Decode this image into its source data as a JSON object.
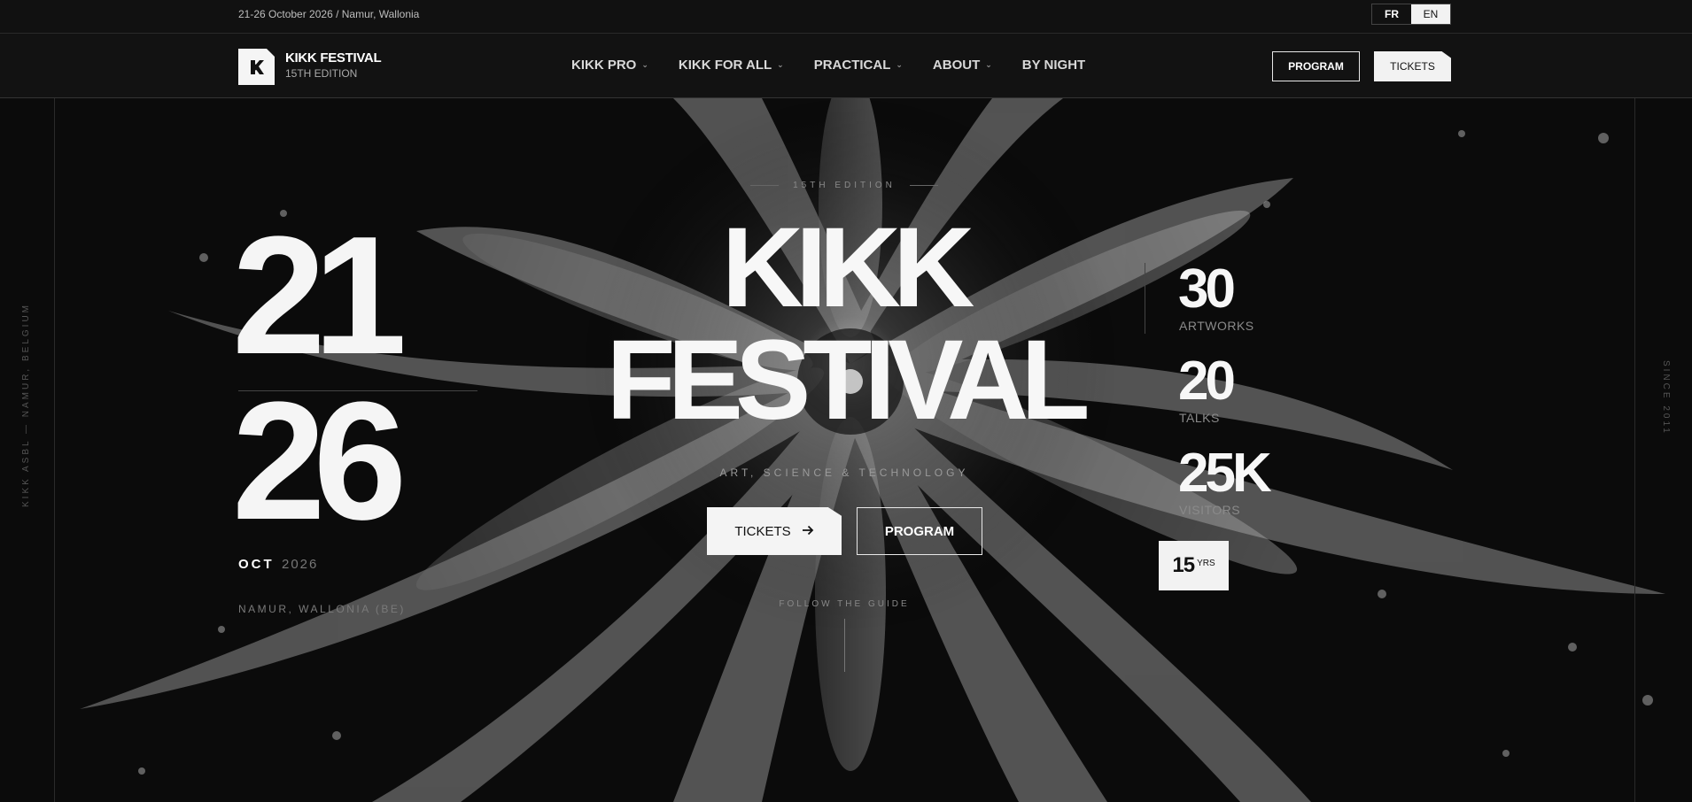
{
  "topbar": {
    "info": "21-26 October 2026 / Namur, Wallonia",
    "lang": [
      "FR",
      "EN"
    ]
  },
  "header": {
    "brand_name": "KIKK FESTIVAL",
    "brand_edition": "15TH EDITION",
    "nav": [
      {
        "label": "KIKK PRO",
        "dropdown": true
      },
      {
        "label": "KIKK FOR ALL",
        "dropdown": true
      },
      {
        "label": "PRACTICAL",
        "dropdown": true
      },
      {
        "label": "ABOUT",
        "dropdown": true
      },
      {
        "label": "BY NIGHT",
        "dropdown": false
      }
    ],
    "program_label": "PROGRAM",
    "tickets_label": "TICKETS"
  },
  "hero": {
    "side_left": "KIKK ASBL — NAMUR, BELGIUM",
    "side_right": "SINCE 2011",
    "date_start": "21",
    "date_end": "26",
    "month": "OCT",
    "year": "2026",
    "location": "NAMUR, WALLONIA (BE)",
    "edition": "15TH EDITION",
    "title_line1": "KIKK",
    "title_line2": "FESTIVAL",
    "tagline": "ART, SCIENCE & TECHNOLOGY",
    "tickets_label": "TICKETS",
    "program_label": "PROGRAM",
    "follow": "FOLLOW THE GUIDE",
    "stats": [
      {
        "value": "30",
        "label": "ARTWORKS"
      },
      {
        "value": "20",
        "label": "TALKS"
      },
      {
        "value": "25K",
        "label": "VISITORS"
      }
    ],
    "badge_value": "15",
    "badge_unit": "YRS"
  },
  "colors": {
    "background": "#0d0d0d",
    "text": "#f5f5f5",
    "muted": "#8a8a8a",
    "button_light": "#f2f2f2"
  },
  "icons": [
    "kikk-logo-icon",
    "chevron-down-icon",
    "arrow-right-icon"
  ]
}
